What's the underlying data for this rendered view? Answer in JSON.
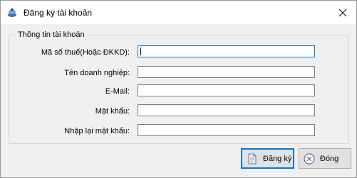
{
  "window": {
    "title": "Đăng ký tài khoản",
    "icon": "app-icon",
    "close_icon": "close-icon"
  },
  "group": {
    "legend": "Thông tin tài khoản",
    "fields": [
      {
        "label": "Mã số thuế(Hoặc ĐKKD):",
        "value": "",
        "placeholder": "",
        "focused": true
      },
      {
        "label": "Tên doanh nghiệp:",
        "value": "",
        "placeholder": ""
      },
      {
        "label": "E-Mail:",
        "value": "",
        "placeholder": ""
      },
      {
        "label": "Mật khẩu:",
        "value": "",
        "placeholder": ""
      },
      {
        "label": "Nhập lại mật khẩu:",
        "value": "",
        "placeholder": ""
      }
    ]
  },
  "buttons": {
    "register_label": "Đăng ký",
    "register_icon": "document-icon",
    "close_label": "Đóng",
    "close_icon": "circle-x-icon"
  },
  "colors": {
    "accent": "#0078d7",
    "background": "#f0f0f0",
    "titlebar": "#ffffff"
  }
}
